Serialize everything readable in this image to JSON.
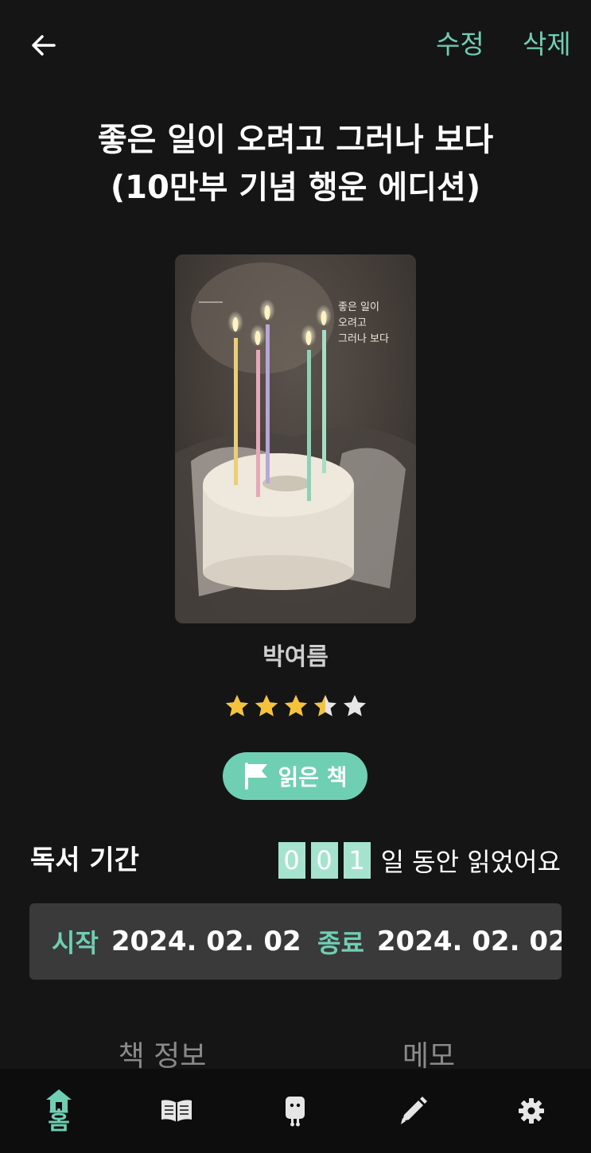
{
  "header": {
    "back_icon": "arrow-left-icon",
    "edit_label": "수정",
    "delete_label": "삭제"
  },
  "book": {
    "title_line1": "좋은 일이 오려고 그러나 보다",
    "title_line2": "(10만부 기념 행운 에디션)",
    "cover_text_line1": "좋은 일이",
    "cover_text_line2": "오려고",
    "cover_text_line3": "그러나 보다",
    "author": "박여름",
    "rating": 3.5,
    "rating_max": 5
  },
  "status": {
    "icon": "flag-icon",
    "label": "읽은 책"
  },
  "reading_period": {
    "title": "독서 기간",
    "digits": [
      "0",
      "0",
      "1"
    ],
    "days_suffix": "일 동안 읽었어요",
    "start_label": "시작",
    "start_value": "2024. 02. 02",
    "end_label": "종료",
    "end_value": "2024. 02. 02"
  },
  "tabs": {
    "info": "책 정보",
    "memo": "메모"
  },
  "bottom_nav": {
    "home_label": "홈",
    "items": [
      "home-icon",
      "book-open-icon",
      "robot-icon",
      "pencil-icon",
      "gear-icon"
    ]
  },
  "colors": {
    "accent": "#6fcfb3",
    "background": "#151515",
    "star": "#f5c33b",
    "star_empty": "#e6e6e6"
  }
}
